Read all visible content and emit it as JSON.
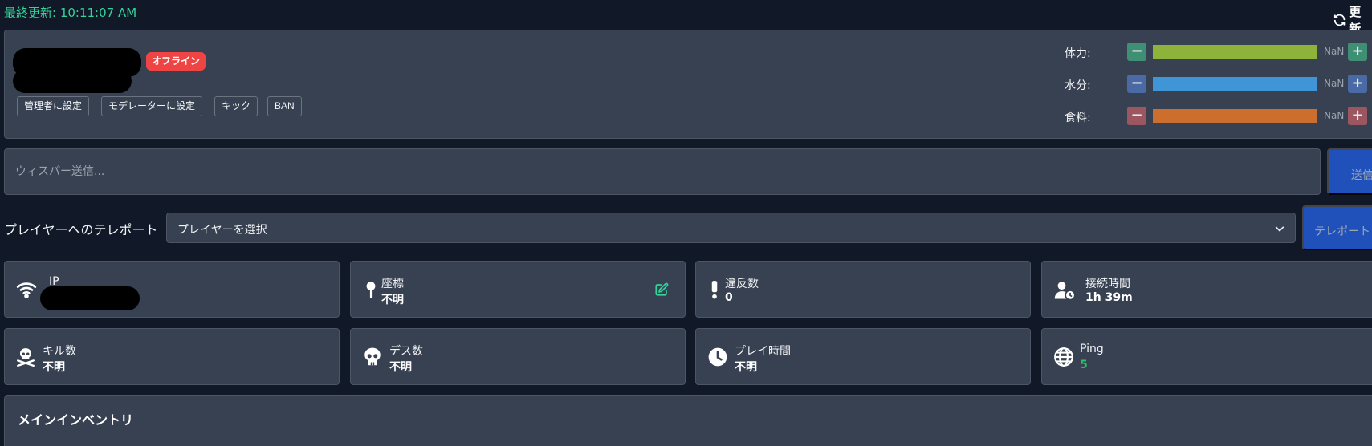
{
  "header": {
    "last_update": "最終更新: 10:11:07 AM",
    "refresh_label": "更新"
  },
  "player": {
    "status": "オフライン",
    "actions": [
      "管理者に設定",
      "モデレーターに設定",
      "キック",
      "BAN"
    ]
  },
  "stats": [
    {
      "label": "体力:",
      "value": "NaN",
      "minus": "−",
      "plus": "+",
      "color": "#8db33a",
      "button_color": "#3f8f74"
    },
    {
      "label": "水分:",
      "value": "NaN",
      "minus": "−",
      "plus": "+",
      "color": "#3f95d6",
      "button_color": "#4a6aa5"
    },
    {
      "label": "食料:",
      "value": "NaN",
      "minus": "−",
      "plus": "+",
      "color": "#cc6f2e",
      "button_color": "#9b5660"
    }
  ],
  "whisper": {
    "placeholder": "ウィスパー送信...",
    "send_label": "送信"
  },
  "teleport": {
    "label": "プレイヤーへのテレポート",
    "selected": "プレイヤーを選択",
    "button_label": "テレポート"
  },
  "info_cards": [
    {
      "name": "ip",
      "label": "IP",
      "value": "",
      "icon": "wifi-icon"
    },
    {
      "name": "coordinates",
      "label": "座標",
      "value": "不明",
      "icon": "map-pin-icon"
    },
    {
      "name": "violations",
      "label": "違反数",
      "value": "0",
      "icon": "exclamation-icon"
    },
    {
      "name": "connection-time",
      "label": "接続時間",
      "value": "1h 39m",
      "icon": "user-clock-icon"
    },
    {
      "name": "kills",
      "label": "キル数",
      "value": "不明",
      "icon": "skull-crossbones-icon"
    },
    {
      "name": "deaths",
      "label": "デス数",
      "value": "不明",
      "icon": "skull-icon"
    },
    {
      "name": "play-time",
      "label": "プレイ時間",
      "value": "不明",
      "icon": "clock-icon"
    },
    {
      "name": "ping",
      "label": "Ping",
      "value": "5",
      "icon": "globe-icon",
      "value_color": "#22c55e"
    }
  ],
  "inventory": {
    "title": "メインインベントリ"
  },
  "colors": {
    "background": "#111827",
    "panel": "#374151",
    "accent_green": "#34d399",
    "offline_red": "#ef4444",
    "primary_blue": "#2563eb"
  }
}
